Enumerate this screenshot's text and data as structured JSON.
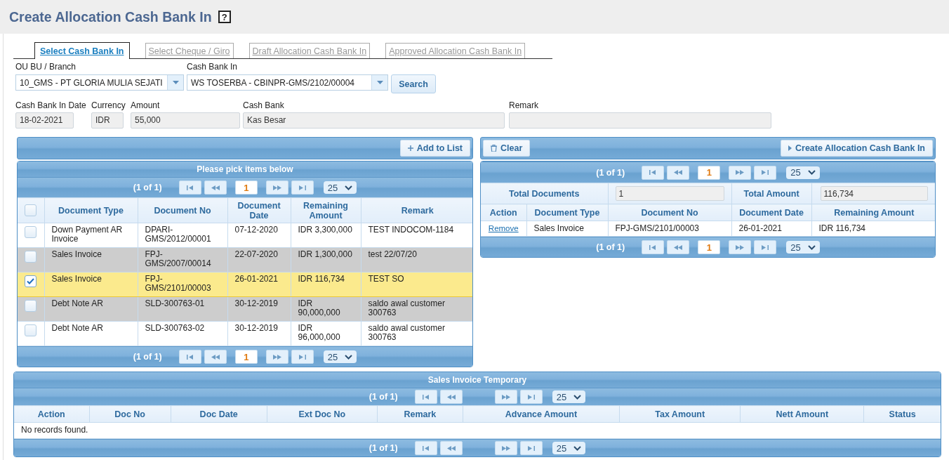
{
  "page_title": "Create Allocation Cash Bank In",
  "help_button": "?",
  "tabs": [
    {
      "label": "Select Cash Bank In",
      "selected": true
    },
    {
      "label": "Select Cheque / Giro",
      "selected": false
    },
    {
      "label": "Draft Allocation Cash Bank In",
      "selected": false
    },
    {
      "label": "Approved Allocation Cash Bank In",
      "selected": false
    }
  ],
  "filters": {
    "ou_label": "OU BU / Branch",
    "ou_value": "10_GMS - PT GLORIA MULIA SEJATI",
    "cash_bank_in_label": "Cash Bank In",
    "cash_bank_in_value": "WS TOSERBA - CBINPR-GMS/2102/00004",
    "search_button": "Search"
  },
  "details": [
    {
      "label": "Cash Bank In Date",
      "value": "18-02-2021"
    },
    {
      "label": "Currency",
      "value": "IDR"
    },
    {
      "label": "Amount",
      "value": "55,000"
    },
    {
      "label": "Cash Bank",
      "value": "Kas Besar"
    },
    {
      "label": "Remark"
    }
  ],
  "pick_panel": {
    "add_button": "Add to List",
    "caption": "Please pick items below",
    "pager_top": {
      "status": "(1 of 1)",
      "current_page": "1",
      "page_size": "25"
    },
    "all_checked": false,
    "columns": [
      "Document Type",
      "Document No",
      "Document Date",
      "Remaining Amount",
      "Remark"
    ],
    "rows": [
      {
        "checked": false,
        "selected": false,
        "cells": [
          "Down Payment AR Invoice",
          "DPARI-GMS/2012/00001",
          "07-12-2020",
          "IDR 3,300,000",
          "TEST INDOCOM-1184"
        ]
      },
      {
        "checked": false,
        "selected": false,
        "cells": [
          "Sales Invoice",
          "FPJ-GMS/2007/00014",
          "22-07-2020",
          "IDR 1,300,000",
          "test 22/07/20"
        ]
      },
      {
        "checked": true,
        "selected": true,
        "cells": [
          "Sales Invoice",
          "FPJ-GMS/2101/00003",
          "26-01-2021",
          "IDR 116,734",
          "TEST SO"
        ]
      },
      {
        "checked": false,
        "selected": false,
        "cells": [
          "Debt Note AR",
          "SLD-300763-01",
          "30-12-2019",
          "IDR 90,000,000",
          "saldo awal customer 300763"
        ]
      },
      {
        "checked": false,
        "selected": false,
        "cells": [
          "Debt Note AR",
          "SLD-300763-02",
          "30-12-2019",
          "IDR 96,000,000",
          "saldo awal customer 300763"
        ]
      }
    ],
    "pager_bottom": {
      "status": "(1 of 1)",
      "current_page": "1",
      "page_size": "25"
    }
  },
  "allocation_panel": {
    "clear_button": "Clear",
    "create_button": "Create Allocation Cash Bank In",
    "pager_top": {
      "status": "(1 of 1)",
      "current_page": "1",
      "page_size": "25"
    },
    "total_documents_label": "Total Documents",
    "total_documents_value": "1",
    "total_amount_label": "Total Amount",
    "total_amount_value": "116,734",
    "columns": [
      "Action",
      "Document Type",
      "Document No",
      "Document Date",
      "Remaining Amount"
    ],
    "rows": [
      {
        "cells": [
          "Remove",
          "Sales Invoice",
          "FPJ-GMS/2101/00003",
          "26-01-2021",
          "IDR 116,734"
        ]
      }
    ],
    "pager_bottom": {
      "status": "(1 of 1)",
      "current_page": "1",
      "page_size": "25"
    }
  },
  "temporary_panel": {
    "caption": "Sales Invoice Temporary",
    "pager_top": {
      "status": "(1 of 1)",
      "page_size": "25"
    },
    "columns": [
      "Action",
      "Doc No",
      "Doc Date",
      "Ext Doc No",
      "Remark",
      "Advance Amount",
      "Tax Amount",
      "Nett Amount",
      "Status"
    ],
    "empty_message": "No records found.",
    "pager_bottom": {
      "status": "(1 of 1)",
      "page_size": "25"
    }
  }
}
